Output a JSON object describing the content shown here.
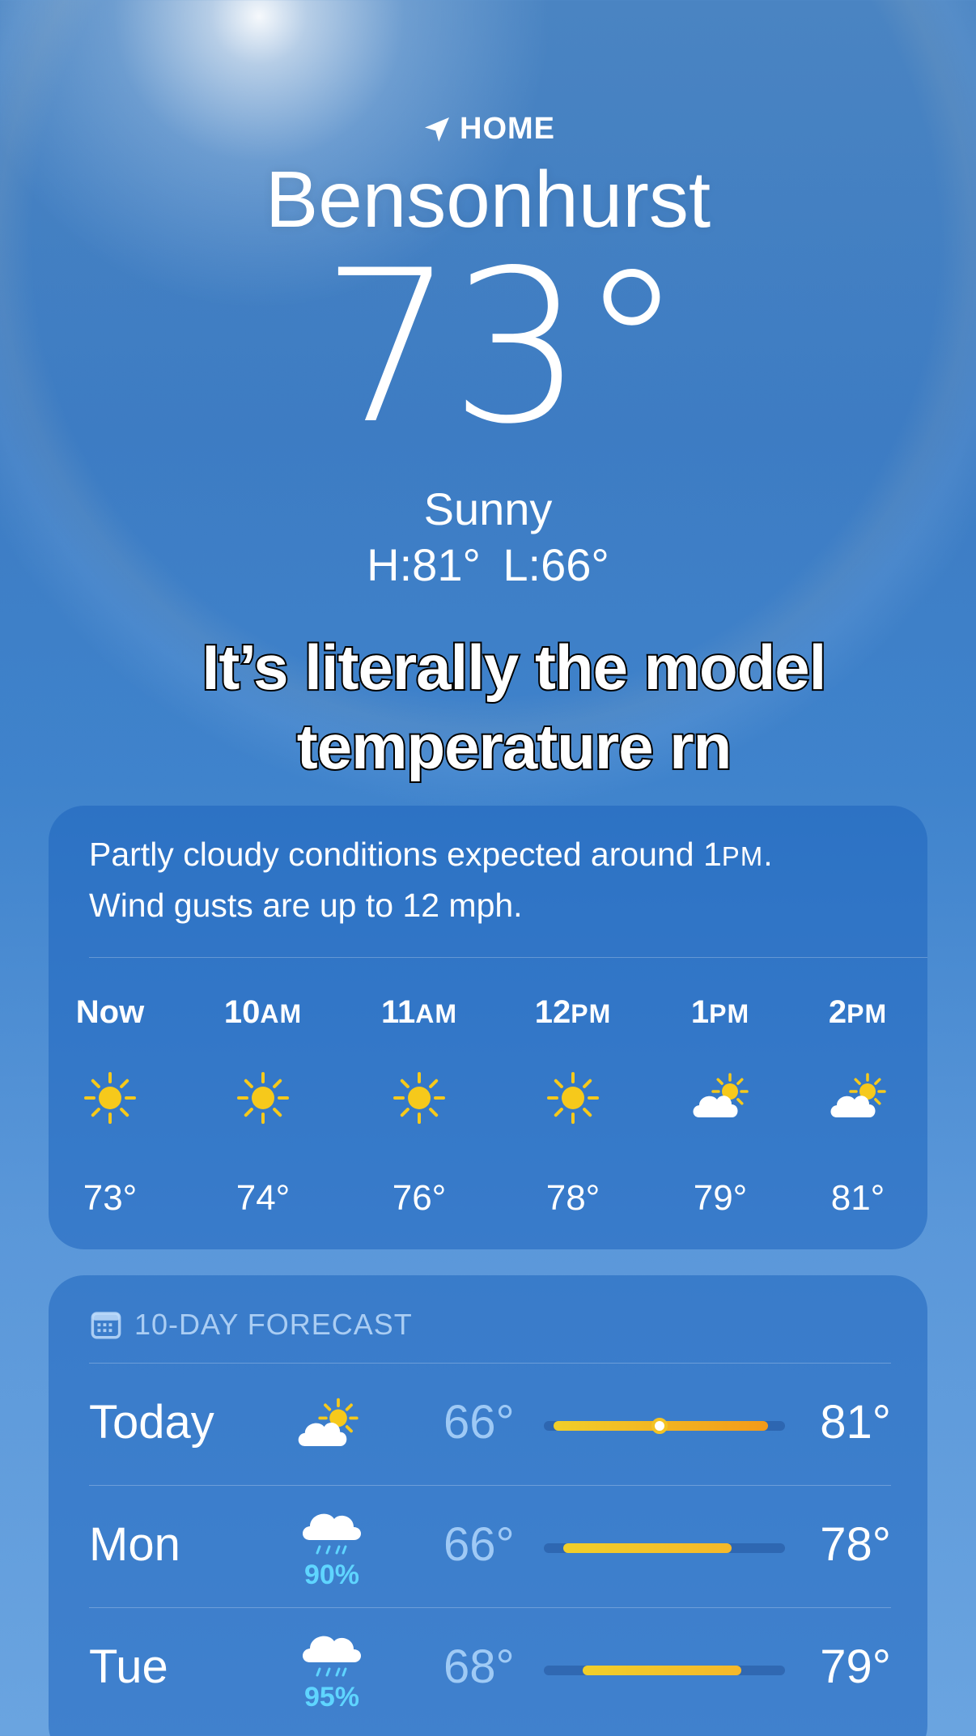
{
  "location": {
    "label": "HOME",
    "city": "Bensonhurst"
  },
  "current": {
    "temp": "73°",
    "condition": "Sunny",
    "hilo": "H:81°  L:66°"
  },
  "caption": {
    "line1": "It’s literally the model",
    "line2": "temperature rn"
  },
  "hourly": {
    "summary_line1_pre": "Partly cloudy conditions expected around 1",
    "summary_line1_sc": "PM",
    "summary_line1_post": ".",
    "summary_line2": "Wind gusts are up to 12 mph.",
    "hours": [
      {
        "time": "Now",
        "suffix": "",
        "icon": "sun-icon",
        "temp": "73°"
      },
      {
        "time": "10",
        "suffix": "AM",
        "icon": "sun-icon",
        "temp": "74°"
      },
      {
        "time": "11",
        "suffix": "AM",
        "icon": "sun-icon",
        "temp": "76°"
      },
      {
        "time": "12",
        "suffix": "PM",
        "icon": "sun-icon",
        "temp": "78°"
      },
      {
        "time": "1",
        "suffix": "PM",
        "icon": "partly-cloudy-icon",
        "temp": "79°"
      },
      {
        "time": "2",
        "suffix": "PM",
        "icon": "partly-cloudy-icon",
        "temp": "81°"
      }
    ]
  },
  "forecast": {
    "title": "10-DAY FORECAST",
    "days": [
      {
        "day": "Today",
        "icon": "partly-cloudy-icon",
        "precip": "",
        "low": "66°",
        "high": "81°",
        "bar_start": 0.04,
        "bar_end": 0.93,
        "current_marker": 0.48
      },
      {
        "day": "Mon",
        "icon": "rain-icon",
        "precip": "90%",
        "low": "66°",
        "high": "78°",
        "bar_start": 0.08,
        "bar_end": 0.78,
        "current_marker": null
      },
      {
        "day": "Tue",
        "icon": "rain-icon",
        "precip": "95%",
        "low": "68°",
        "high": "79°",
        "bar_start": 0.16,
        "bar_end": 0.82,
        "current_marker": null
      }
    ]
  },
  "colors": {
    "sun": "#f6c91b",
    "bar_cool": "#f1cf2a",
    "bar_warm": "#f39a19",
    "precip": "#5fd5ff"
  }
}
